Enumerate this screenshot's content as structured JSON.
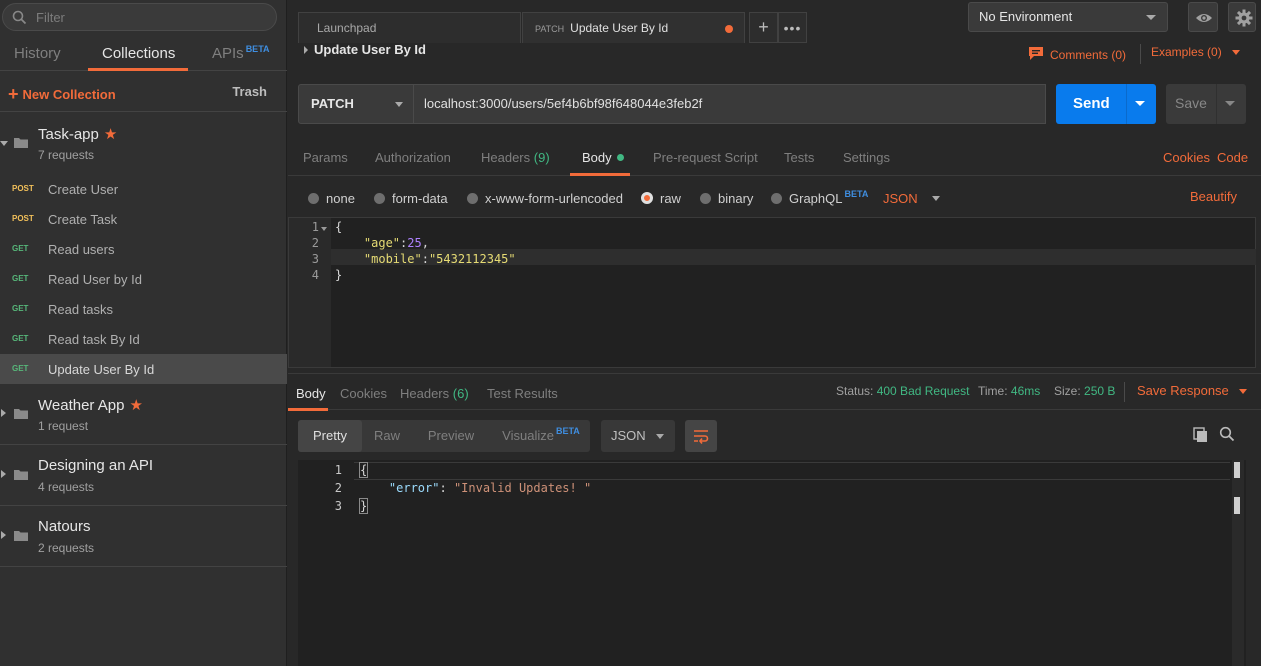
{
  "sidebar": {
    "filter_placeholder": "Filter",
    "tabs": [
      {
        "label": "History"
      },
      {
        "label": "Collections"
      },
      {
        "label": "APIs",
        "badge": "BETA"
      }
    ],
    "new_collection": "New Collection",
    "trash": "Trash",
    "collections": [
      {
        "name": "Task-app",
        "count": "7 requests",
        "starred": true
      },
      {
        "name": "Weather App",
        "count": "1 request",
        "starred": true
      },
      {
        "name": "Designing an API",
        "count": "4 requests",
        "starred": false
      },
      {
        "name": "Natours",
        "count": "2 requests",
        "starred": false
      }
    ],
    "requests": [
      {
        "method": "POST",
        "name": "Create User"
      },
      {
        "method": "POST",
        "name": "Create Task"
      },
      {
        "method": "GET",
        "name": "Read users"
      },
      {
        "method": "GET",
        "name": "Read User by Id"
      },
      {
        "method": "GET",
        "name": "Read tasks"
      },
      {
        "method": "GET",
        "name": "Read task By Id"
      },
      {
        "method": "GET",
        "name": "Update User By Id"
      }
    ]
  },
  "tabs": {
    "launchpad": "Launchpad",
    "active_method": "PATCH",
    "active_title": "Update User By Id"
  },
  "environment": "No Environment",
  "request": {
    "title": "Update User By Id",
    "comments": "Comments (0)",
    "examples": "Examples (0)",
    "method": "PATCH",
    "url": "localhost:3000/users/5ef4b6bf98f648044e3feb2f",
    "send": "Send",
    "save": "Save"
  },
  "request_tabs": {
    "params": "Params",
    "authorization": "Authorization",
    "headers": "Headers",
    "headers_count": "(9)",
    "body": "Body",
    "prerequest": "Pre-request Script",
    "tests": "Tests",
    "settings": "Settings",
    "cookies": "Cookies",
    "code": "Code"
  },
  "body_types": {
    "none": "none",
    "form_data": "form-data",
    "urlencoded": "x-www-form-urlencoded",
    "raw": "raw",
    "binary": "binary",
    "graphql": "GraphQL",
    "graphql_badge": "BETA",
    "format": "JSON",
    "beautify": "Beautify"
  },
  "request_body": {
    "line_numbers": [
      "1",
      "2",
      "3",
      "4"
    ],
    "open_brace": "{",
    "age_key": "\"age\"",
    "age_value": "25",
    "mobile_key": "\"mobile\"",
    "mobile_value": "\"5432112345\"",
    "close_brace": "}"
  },
  "response_tabs": {
    "body": "Body",
    "cookies": "Cookies",
    "headers": "Headers",
    "headers_count": "(6)",
    "test_results": "Test Results",
    "status_label": "Status:",
    "status_value": "400 Bad Request",
    "time_label": "Time:",
    "time_value": "46ms",
    "size_label": "Size:",
    "size_value": "250 B",
    "save_response": "Save Response"
  },
  "response_view": {
    "pretty": "Pretty",
    "raw": "Raw",
    "preview": "Preview",
    "visualize": "Visualize",
    "visualize_badge": "BETA",
    "format": "JSON"
  },
  "response_body": {
    "line_numbers": [
      "1",
      "2",
      "3"
    ],
    "open_brace": "{",
    "error_key": "\"error\"",
    "error_value": "\"Invalid Updates! \"",
    "close_brace": "}"
  },
  "colors": {
    "accent": "#f26b3a",
    "send": "#097bed",
    "post": "#f2c05a",
    "get": "#57b77a",
    "status_green": "#41b883"
  }
}
